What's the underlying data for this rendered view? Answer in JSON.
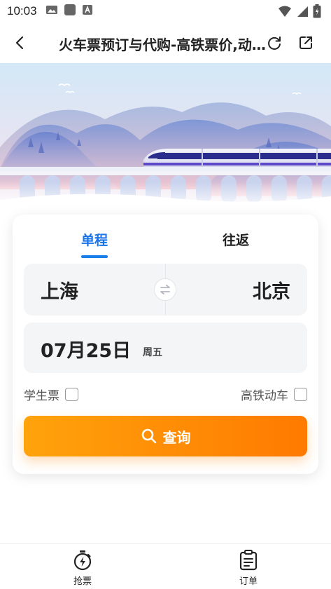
{
  "status_bar": {
    "time": "10:03",
    "left_icons": [
      "image-icon",
      "app-square-icon",
      "text-a-icon"
    ],
    "right_icons": [
      "wifi-icon",
      "signal-icon",
      "battery-icon"
    ]
  },
  "header": {
    "title": "火车票预订与代购-高铁票价,动...",
    "back_icon": "chevron-left-icon",
    "refresh_icon": "refresh-icon",
    "share_icon": "share-icon"
  },
  "trip_tabs": [
    {
      "label": "单程",
      "selected": true
    },
    {
      "label": "往返",
      "selected": false
    }
  ],
  "route": {
    "from": "上海",
    "to": "北京",
    "swap_icon": "swap-arrows-icon"
  },
  "date": {
    "value": "07月25日",
    "weekday": "周五"
  },
  "options": {
    "student_ticket": {
      "label": "学生票",
      "checked": false
    },
    "high_speed": {
      "label": "高铁动车",
      "checked": false
    }
  },
  "search_button": {
    "label": "查询",
    "icon": "search-icon"
  },
  "bottom_nav": [
    {
      "label": "抢票",
      "icon": "stopwatch-lightning-icon"
    },
    {
      "label": "订单",
      "icon": "clipboard-icon"
    }
  ],
  "colors": {
    "accent_blue": "#1a73e8",
    "button_orange": "#ff8a05",
    "text_dark": "#222222"
  }
}
